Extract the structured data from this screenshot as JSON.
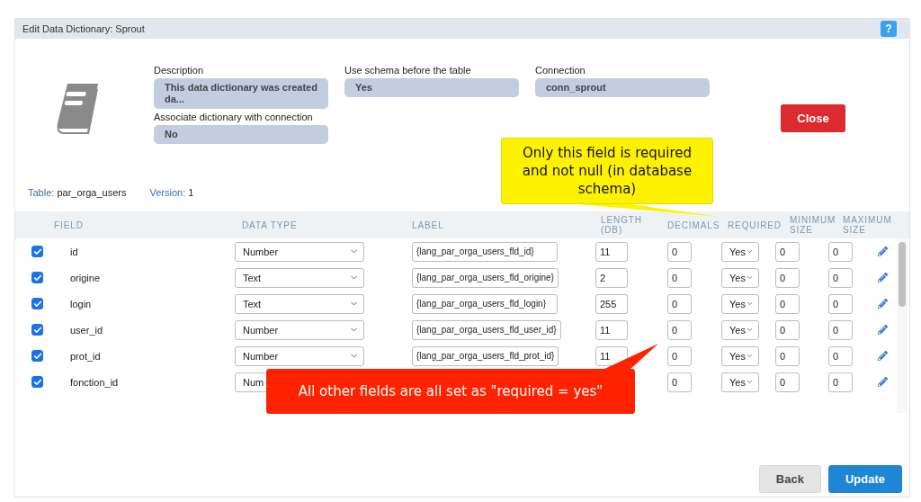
{
  "window": {
    "title": "Edit Data Dictionary: Sprout",
    "help": "?"
  },
  "settings": [
    {
      "label": "Description",
      "value": "This data dictionary was created da..."
    },
    {
      "label": "Use schema before the table",
      "value": "Yes"
    },
    {
      "label": "Connection",
      "value": "conn_sprout"
    },
    {
      "label": "Associate dictionary with connection",
      "value": "No"
    }
  ],
  "close_button": "Close",
  "table_info": {
    "table_label": "Table:",
    "table": "par_orga_users",
    "version_label": "Version:",
    "version": "1"
  },
  "columns": [
    "FIELD",
    "DATA TYPE",
    "LABEL",
    "LENGTH (DB)",
    "DECIMALS",
    "REQUIRED",
    "MINIMUM SIZE",
    "MAXIMUM SIZE"
  ],
  "rows": [
    {
      "checked": true,
      "field": "id",
      "data_type": "Number",
      "label": "{lang_par_orga_users_fld_id}",
      "length": "11",
      "decimals": "0",
      "required": "Yes",
      "minimum_size": "0",
      "maximum_size": "0"
    },
    {
      "checked": true,
      "field": "origine",
      "data_type": "Text",
      "label": "{lang_par_orga_users_fld_origine}",
      "length": "2",
      "decimals": "0",
      "required": "Yes",
      "minimum_size": "0",
      "maximum_size": "0"
    },
    {
      "checked": true,
      "field": "login",
      "data_type": "Text",
      "label": "{lang_par_orga_users_fld_login}",
      "length": "255",
      "decimals": "0",
      "required": "Yes",
      "minimum_size": "0",
      "maximum_size": "0"
    },
    {
      "checked": true,
      "field": "user_id",
      "data_type": "Number",
      "label": "{lang_par_orga_users_fld_user_id}",
      "length": "11",
      "decimals": "0",
      "required": "Yes",
      "minimum_size": "0",
      "maximum_size": "0"
    },
    {
      "checked": true,
      "field": "prot_id",
      "data_type": "Number",
      "label": "{lang_par_orga_users_fld_prot_id}",
      "length": "11",
      "decimals": "0",
      "required": "Yes",
      "minimum_size": "0",
      "maximum_size": "0"
    },
    {
      "checked": true,
      "field": "fonction_id",
      "data_type": "Num",
      "decimals": "0",
      "required": "Yes",
      "minimum_size": "0",
      "maximum_size": "0"
    }
  ],
  "callouts": [
    {
      "kind": "yellow",
      "text": "Only this field is required and not null (in database schema)"
    },
    {
      "kind": "red",
      "text": "All other fields are all set as \"required = yes\""
    }
  ],
  "buttons": [
    {
      "label": "Back",
      "kind": "secondary"
    },
    {
      "label": "Update",
      "kind": "primary"
    }
  ]
}
